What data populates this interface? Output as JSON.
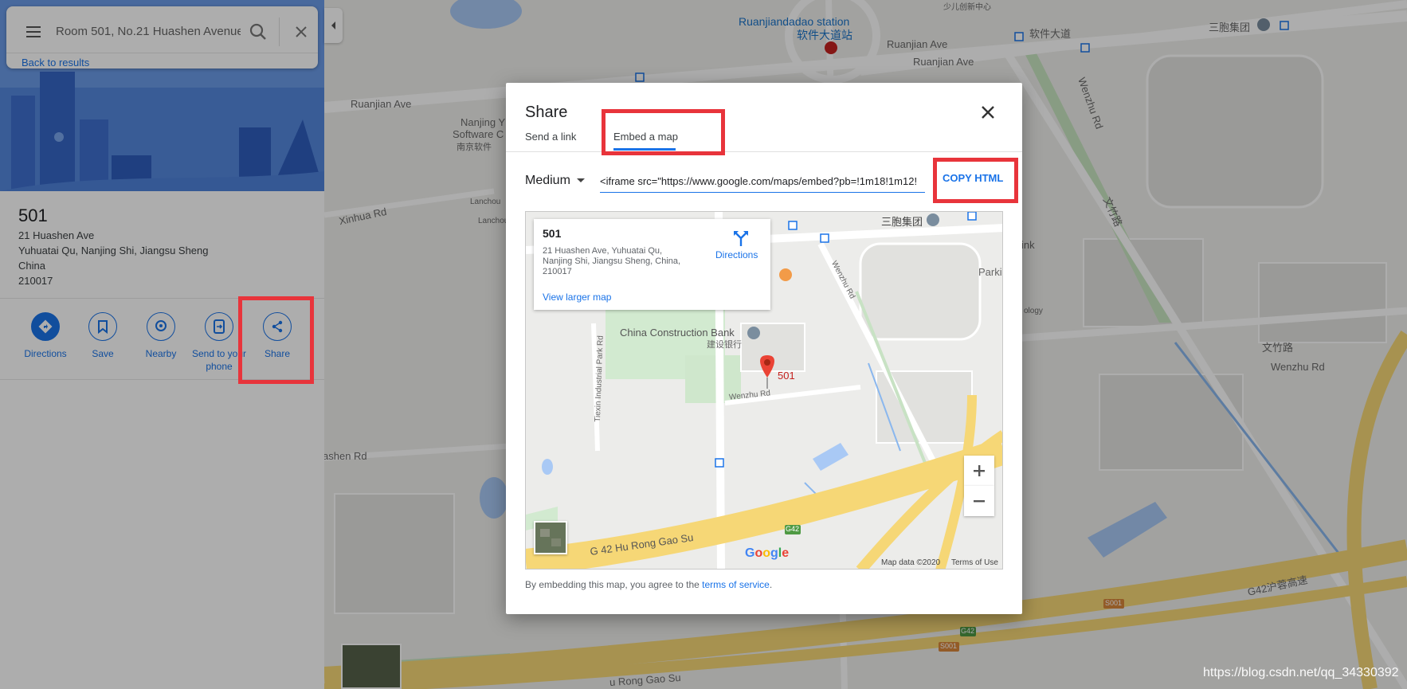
{
  "search": {
    "query": "Room 501, No.21 Huashen Avenue",
    "back_label": "Back to results"
  },
  "place": {
    "name": "501",
    "address_lines": [
      "21 Huashen Ave",
      "Yuhuatai Qu, Nanjing Shi, Jiangsu Sheng",
      "China",
      "210017"
    ]
  },
  "actions": [
    {
      "label": "Directions",
      "icon": "directions-icon"
    },
    {
      "label": "Save",
      "icon": "bookmark-icon"
    },
    {
      "label": "Nearby",
      "icon": "nearby-icon"
    },
    {
      "label": "Send to your phone",
      "icon": "send-to-phone-icon"
    },
    {
      "label": "Share",
      "icon": "share-icon"
    }
  ],
  "dialog": {
    "title": "Share",
    "tabs": [
      {
        "label": "Send a link",
        "active": false
      },
      {
        "label": "Embed a map",
        "active": true
      }
    ],
    "size_select": "Medium",
    "iframe_code": "<iframe src=\"https://www.google.com/maps/embed?pb=!1m18!1m12!",
    "copy_label": "COPY HTML",
    "disclaimer_prefix": "By embedding this map, you agree to the ",
    "disclaimer_link": "terms of service",
    "disclaimer_suffix": "."
  },
  "embed_map": {
    "info_card": {
      "name": "501",
      "address": "21 Huashen Ave, Yuhuatai Qu, Nanjing Shi, Jiangsu Sheng, China, 210017",
      "directions_label": "Directions",
      "larger_map_label": "View larger map"
    },
    "labels": {
      "sanbao": "三胞集团",
      "ccb": "China Construction Bank",
      "ccb_cn": "建设银行",
      "marker": "501",
      "wenzhu_rd": "Wenzhu Rd",
      "wenzhu_rd_v": "Wenzhu Rd",
      "tiexin": "Tiexin Industrial Park Rd",
      "g42": "G42",
      "hu_rong": "G 42 Hu Rong Gao Su",
      "parki": "Parki",
      "google": "Google",
      "map_data": "Map data ©2020",
      "terms": "Terms of Use"
    }
  },
  "background_labels": {
    "ruanjian_station": "Ruanjiandadao station",
    "ruanjian_station_cn": "软件大道站",
    "ruanjian_ave_1": "Ruanjian Ave",
    "ruanjian_ave_2": "Ruanjian Ave",
    "ruanjian_ave_3": "Ruanjian Ave",
    "ruanjian_cn": "软件大道",
    "sanbao": "三胞集团",
    "nanjing_1": "Nanjing Y",
    "nanjing_2": "Software C",
    "nanjing_cn": "南京软件",
    "xinhua_rd": "Xinhua Rd",
    "lanchou_1": "Lanchou",
    "lanchou_2": "Lanchou",
    "wenzhu_rd_v": "Wenzhu Rd",
    "wenzhu_rd": "Wenzhu Rd",
    "wenzhu_cn": "文竹路",
    "wenzhu_cn_v": "文竹路",
    "ink": "ink",
    "ology": "ology",
    "huashen_rd": "ashen Rd",
    "g42_cn": "G42沪蓉高速",
    "hu_rong": "u Rong Gao Su",
    "s001": "S001",
    "g42_badge": "G42",
    "kids": "少儿创新中心"
  },
  "watermark": "https://blog.csdn.net/qq_34330392",
  "colors": {
    "accent": "#1a73e8",
    "highlight_box": "#e8343b",
    "marker": "#ea4335",
    "highway": "#f6d776"
  }
}
